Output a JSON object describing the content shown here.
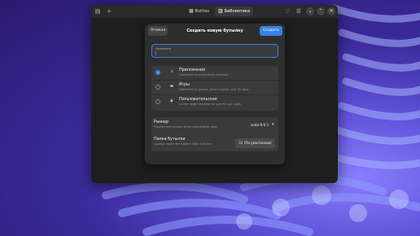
{
  "window": {
    "tabs": [
      {
        "label": "Bottles",
        "icon": "bottle-icon"
      },
      {
        "label": "Библиотека",
        "icon": "library-icon"
      }
    ],
    "titlebar_icons": [
      "sidebar-toggle-icon",
      "add-icon",
      "heart-icon",
      "menu-icon",
      "minimize-icon",
      "maximize-icon",
      "close-icon"
    ]
  },
  "dialog": {
    "cancel_label": "Отмена",
    "title": "Создать новую бутылку",
    "create_label": "Создать",
    "name_field": {
      "label": "Название",
      "value": ""
    },
    "environments": [
      {
        "title": "Приложение",
        "subtitle": "Optimized for productivity software",
        "icon": "application-icon",
        "selected": true
      },
      {
        "title": "Игры",
        "subtitle": "Optimized for games, game engines, and 3D apps",
        "icon": "gamepad-icon",
        "selected": false
      },
      {
        "title": "Пользовательская",
        "subtitle": "A clean state intended for specific use cases",
        "icon": "custom-icon",
        "selected": false
      }
    ],
    "runner": {
      "title": "Раннер",
      "subtitle": "Provider and version of the compatibility layer",
      "value": "soda-9.0-1"
    },
    "folder": {
      "title": "Папка бутылки",
      "subtitle": "Location where the bottle's data is stored",
      "button_label": "(По умолчанию)"
    }
  },
  "colors": {
    "accent": "#3584e4",
    "window_bg": "#1e1e1e",
    "dialog_bg": "#2e2e2e",
    "row_bg": "#3a3a3a"
  }
}
